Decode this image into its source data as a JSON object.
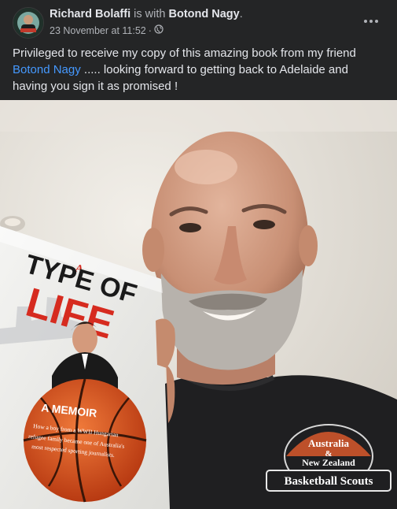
{
  "header": {
    "author": "Richard Bolaffi",
    "with_text": "is with",
    "tagged": "Botond Nagy",
    "period": ".",
    "date": "23 November at 11:52",
    "separator": "·",
    "audience_icon": "globe-icon",
    "more_icon": "ellipsis-icon"
  },
  "post": {
    "text_before": "Privileged to receive my copy of this amazing book from my friend ",
    "mention": "Botond Nagy",
    "text_after": " ..... looking forward to getting back to Adelaide and having you sign it as promised !"
  },
  "photo": {
    "book": {
      "title_a": "A",
      "title_line1": "TYPE OF",
      "title_line2": "LIFE",
      "subtitle": "A MEMOIR",
      "blurb_line1": "How a boy from a WWII Hungarian",
      "blurb_line2": "refugee family became one of Australia's",
      "blurb_line3": "most respected sporting journalists."
    },
    "shirt": {
      "line1": "Australia",
      "line2": "&",
      "line3": "New Zealand",
      "line4": "Basketball Scouts"
    }
  },
  "colors": {
    "background": "#242526",
    "text": "#e4e6eb",
    "muted": "#b0b3b8",
    "link": "#4599ff",
    "book_red": "#d62b1f"
  }
}
